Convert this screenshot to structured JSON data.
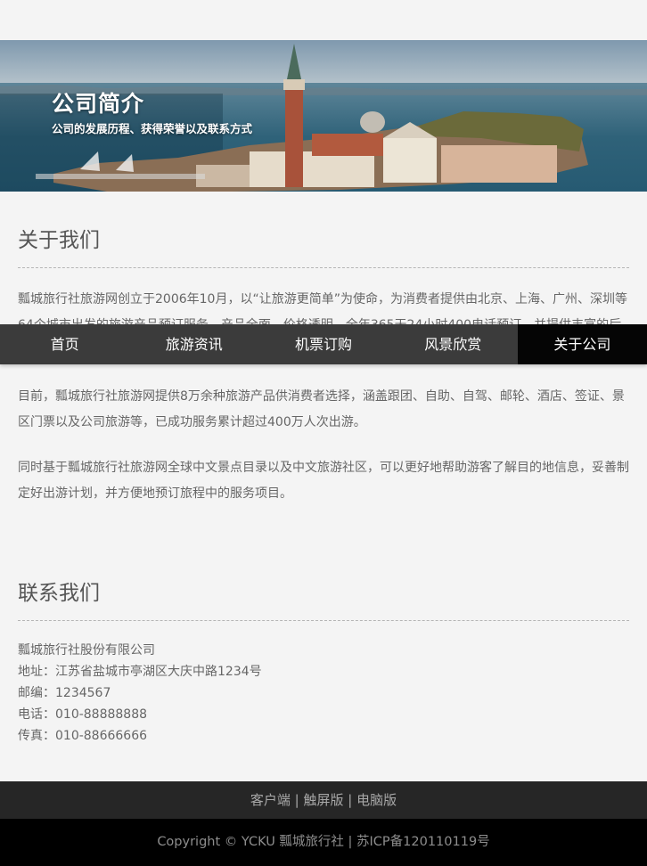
{
  "banner": {
    "title": "公司简介",
    "subtitle": "公司的发展历程、获得荣誉以及联系方式"
  },
  "about": {
    "heading": "关于我们",
    "paragraphs": [
      "瓢城旅行社旅游网创立于2006年10月，以“让旅游更简单”为使命，为消费者提供由北京、上海、广州、深圳等64个城市出发的旅游产品预订服务，产品全面，价格透明，全年365天24小时400电话预订，并提供丰富的后续服务和保障。",
      "目前，瓢城旅行社旅游网提供8万余种旅游产品供消费者选择，涵盖跟团、自助、自驾、邮轮、酒店、签证、景区门票以及公司旅游等，已成功服务累计超过400万人次出游。",
      "同时基于瓢城旅行社旅游网全球中文景点目录以及中文旅游社区，可以更好地帮助游客了解目的地信息，妥善制定好出游计划，并方便地预订旅程中的服务项目。"
    ]
  },
  "contact": {
    "heading": "联系我们",
    "company": "瓢城旅行社股份有限公司",
    "address": "地址：江苏省盐城市亭湖区大庆中路1234号",
    "postcode": "邮编：1234567",
    "phone": "电话：010-88888888",
    "fax": "传真：010-88666666"
  },
  "nav": {
    "items": [
      "首页",
      "旅游资讯",
      "机票订购",
      "风景欣赏",
      "关于公司"
    ],
    "active": "关于公司"
  },
  "footer": {
    "links": [
      "客户端",
      "触屏版",
      "电脑版"
    ],
    "copyright": "Copyright © YCKU 瓢城旅行社 | 苏ICP备120110119号"
  },
  "colors": {
    "nav_bg": "#3b3b3b",
    "nav_active_bg": "#050505",
    "footer_links_bg": "#262626",
    "footer_copy_bg": "#000000"
  }
}
